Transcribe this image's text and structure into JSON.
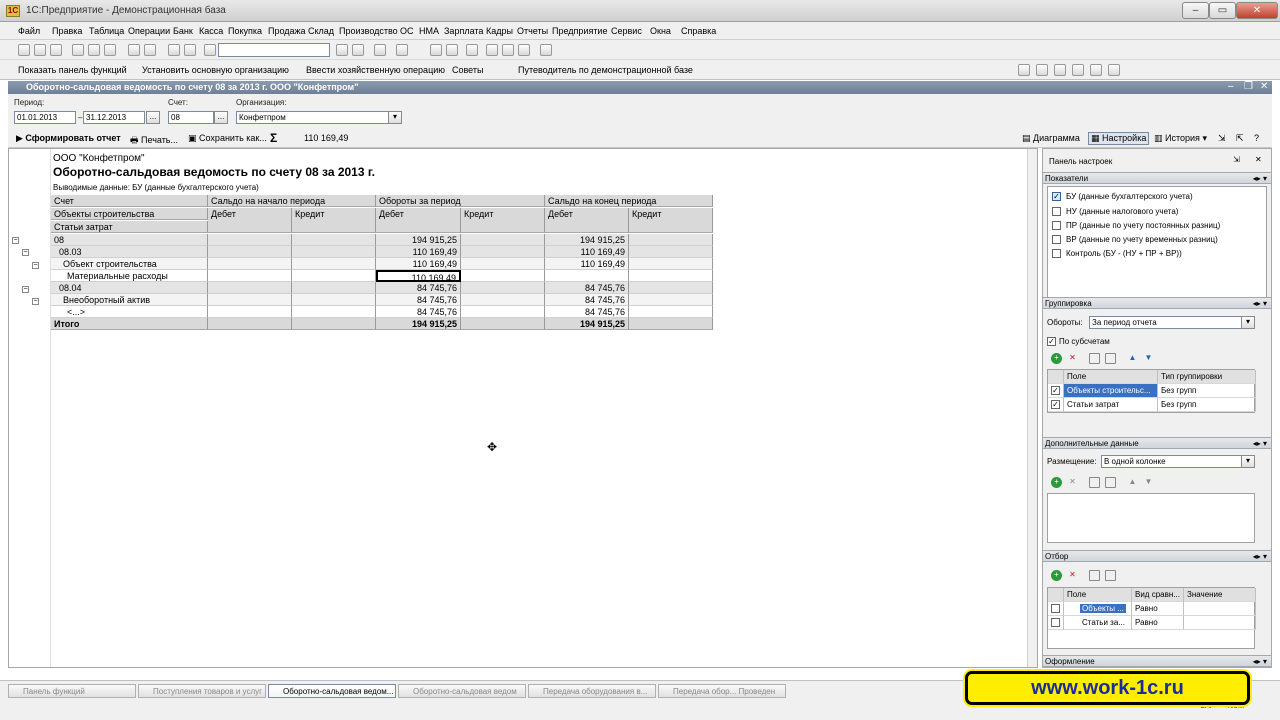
{
  "window": {
    "title": "1С:Предприятие - Демонстрационная база",
    "app_badge": "1С"
  },
  "menu": [
    "Файл",
    "Правка",
    "Таблица",
    "Операции",
    "Банк",
    "Касса",
    "Покупка",
    "Продажа",
    "Склад",
    "Производство",
    "ОС",
    "НМА",
    "Зарплата",
    "Кадры",
    "Отчеты",
    "Предприятие",
    "Сервис",
    "Окна",
    "Справка"
  ],
  "toolbar2": {
    "show_panel": "Показать панель функций",
    "set_org": "Установить основную организацию",
    "enter_op": "Ввести хозяйственную операцию",
    "tips": "Советы",
    "guide": "Путеводитель по демонстрационной базе"
  },
  "doc": {
    "title": "Оборотно-сальдовая ведомость по счету 08 за 2013 г. ООО \"Конфетпром\""
  },
  "params": {
    "period_label": "Период:",
    "date_from": "01.01.2013",
    "date_to": "31.12.2013",
    "account_label": "Счет:",
    "account": "08",
    "org_label": "Организация:",
    "org": "Конфетпром"
  },
  "actions": {
    "generate": "Сформировать отчет",
    "print": "Печать...",
    "save": "Сохранить как...",
    "sum_sign": "Σ",
    "sum_value": "110 169,49",
    "diagram": "Диаграмма",
    "settings": "Настройка",
    "history": "История"
  },
  "report": {
    "org": "ООО \"Конфетпром\"",
    "title": "Оборотно-сальдовая ведомость по счету 08 за 2013 г.",
    "subtitle": "Выводимые данные:  БУ (данные бухгалтерского учета)",
    "header": {
      "account": "Счет",
      "objects": "Объекты строительства",
      "cost_items": "Статьи затрат",
      "opening": "Сальдо на начало периода",
      "turnover": "Обороты за период",
      "closing": "Сальдо на конец периода",
      "debit": "Дебет",
      "credit": "Кредит"
    },
    "rows": [
      {
        "name": "08",
        "open_d": "",
        "open_c": "",
        "turn_d": "194 915,25",
        "turn_c": "",
        "close_d": "194 915,25",
        "close_c": ""
      },
      {
        "name": "08.03",
        "open_d": "",
        "open_c": "",
        "turn_d": "110 169,49",
        "turn_c": "",
        "close_d": "110 169,49",
        "close_c": ""
      },
      {
        "name": "Объект строительства",
        "open_d": "",
        "open_c": "",
        "turn_d": "110 169,49",
        "turn_c": "",
        "close_d": "110 169,49",
        "close_c": ""
      },
      {
        "name": "Материальные расходы",
        "open_d": "",
        "open_c": "",
        "turn_d": "110 169,49",
        "turn_c": "",
        "close_d": "",
        "close_c": ""
      },
      {
        "name": "08.04",
        "open_d": "",
        "open_c": "",
        "turn_d": "84 745,76",
        "turn_c": "",
        "close_d": "84 745,76",
        "close_c": ""
      },
      {
        "name": "Внеоборотный актив",
        "open_d": "",
        "open_c": "",
        "turn_d": "84 745,76",
        "turn_c": "",
        "close_d": "84 745,76",
        "close_c": ""
      },
      {
        "name": "<...>",
        "open_d": "",
        "open_c": "",
        "turn_d": "84 745,76",
        "turn_c": "",
        "close_d": "84 745,76",
        "close_c": ""
      },
      {
        "name": "Итого",
        "open_d": "",
        "open_c": "",
        "turn_d": "194 915,25",
        "turn_c": "",
        "close_d": "194 915,25",
        "close_c": ""
      }
    ]
  },
  "panel": {
    "title": "Панель настроек",
    "indicators_title": "Показатели",
    "indicators": [
      {
        "label": "БУ (данные бухгалтерского учета)",
        "checked": true
      },
      {
        "label": "НУ (данные налогового учета)",
        "checked": false
      },
      {
        "label": "ПР (данные по учету постоянных разниц)",
        "checked": false
      },
      {
        "label": "ВР (данные по учету временных разниц)",
        "checked": false
      },
      {
        "label": "Контроль (БУ - (НУ + ПР + ВР))",
        "checked": false
      }
    ],
    "grouping_title": "Группировка",
    "turnover_label": "Обороты:",
    "turnover_value": "За период отчета",
    "by_subaccounts": "По субсчетам",
    "group_cols": {
      "field": "Поле",
      "type": "Тип группировки"
    },
    "group_rows": [
      {
        "field": "Объекты строительс...",
        "type": "Без групп"
      },
      {
        "field": "Статьи затрат",
        "type": "Без групп"
      }
    ],
    "extra_title": "Дополнительные данные",
    "placement_label": "Размещение:",
    "placement_value": "В одной колонке",
    "filter_title": "Отбор",
    "filter_cols": {
      "field": "Поле",
      "cmp": "Вид сравн...",
      "value": "Значение"
    },
    "filter_rows": [
      {
        "field": "Объекты ...",
        "cmp": "Равно",
        "value": ""
      },
      {
        "field": "Статьи за...",
        "cmp": "Равно",
        "value": ""
      }
    ],
    "design_title": "Оформление"
  },
  "taskbar": [
    {
      "label": "Панель функций",
      "active": false
    },
    {
      "label": "Поступления товаров и услуг",
      "active": false
    },
    {
      "label": "Оборотно-сальдовая ведом...",
      "active": true
    },
    {
      "label": "Оборотно-сальдовая ведом",
      "active": false
    },
    {
      "label": "Передача оборудования в...",
      "active": false
    },
    {
      "label": "Передача обор... Проведен",
      "active": false
    }
  ],
  "status": {
    "caps": "CAP",
    "num": "NUM"
  },
  "banner": {
    "text": "www.work-1c.ru"
  }
}
